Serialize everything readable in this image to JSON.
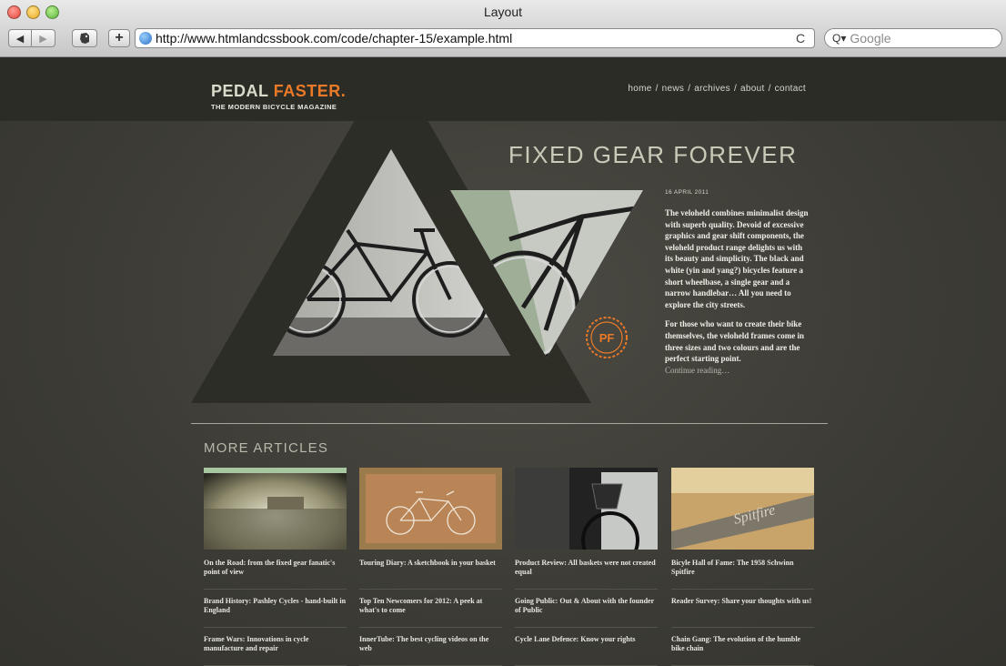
{
  "window": {
    "title": "Layout"
  },
  "toolbar": {
    "back_icon": "back-arrow",
    "forward_icon": "forward-arrow",
    "evernote_icon": "evernote-elephant",
    "add_bookmark": "+",
    "url": "http://www.htmlandcssbook.com/code/chapter-15/example.html",
    "reload": "C",
    "search_placeholder": "Google"
  },
  "site": {
    "logo_part1": "PEDAL",
    "logo_part2": "FASTER.",
    "tagline": "THE MODERN BICYCLE MAGAZINE",
    "nav": [
      "home",
      "news",
      "archives",
      "about",
      "contact"
    ],
    "nav_separator": "/",
    "badge_text": "PF"
  },
  "article": {
    "title": "FIXED GEAR FOREVER",
    "date": "16 APRIL 2011",
    "paragraphs": [
      "The veloheld combines minimalist design with superb quality. Devoid of excessive graphics and gear shift components, the veloheld product range delights us with its beauty and simplicity. The black and white (yin and yang?) bicycles feature a short wheelbase, a single gear and a narrow handlebar… All you need to explore the city streets.",
      "For those who want to create their bike themselves, the veloheld frames come in three sizes and two colours and are the perfect starting point."
    ],
    "read_more": "Continue reading…"
  },
  "more_articles": {
    "heading": "MORE ARTICLES",
    "columns": [
      [
        "On the Road: from the fixed gear fanatic's point of view",
        "Brand History: Pashley Cycles - hand-built in England",
        "Frame Wars: Innovations in cycle manufacture and repair"
      ],
      [
        "Touring Diary: A sketchbook in your basket",
        "Top Ten Newcomers for 2012: A peek at what's to come",
        "InnerTube: The best cycling videos on the web"
      ],
      [
        "Product Review: All baskets were not created equal",
        "Going Public: Out & About with the founder of Public",
        "Cycle Lane Defence: Know your rights"
      ],
      [
        "Bicyle Hall of Fame: The 1958 Schwinn Spitfire",
        "Reader Survey: Share your thoughts with us!",
        "Chain Gang: The evolution of the humble bike chain"
      ]
    ]
  },
  "colors": {
    "accent": "#ea7a27",
    "background": "#3b3a34",
    "dark_band": "#2c2c26",
    "triangle": "#2f2f28",
    "headline": "#c9cbb9"
  }
}
